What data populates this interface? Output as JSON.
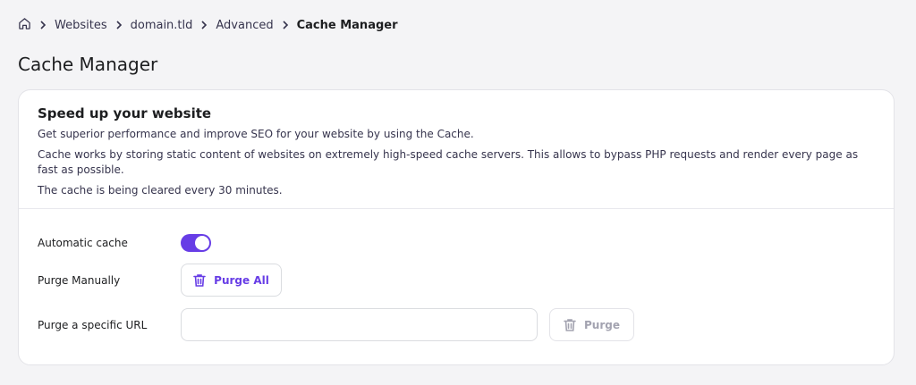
{
  "breadcrumb": {
    "home_icon": "home-icon",
    "items": [
      "Websites",
      "domain.tld",
      "Advanced",
      "Cache Manager"
    ]
  },
  "page_title": "Cache Manager",
  "card": {
    "title": "Speed up your website",
    "paragraphs": [
      "Get superior performance and improve SEO for your website by using the Cache.",
      "Cache works by storing static content of websites on extremely high-speed cache servers. This allows to bypass PHP requests and render every page as fast as possible.",
      "The cache is being cleared every 30 minutes."
    ]
  },
  "settings": {
    "automatic_cache": {
      "label": "Automatic cache",
      "enabled": true
    },
    "purge_manually": {
      "label": "Purge Manually",
      "button_label": "Purge All",
      "icon": "trash-icon"
    },
    "purge_url": {
      "label": "Purge a specific URL",
      "input_value": "",
      "input_placeholder": "",
      "button_label": "Purge",
      "icon": "trash-icon"
    }
  },
  "colors": {
    "accent": "#673de6",
    "background": "#f4f4f6",
    "card": "#ffffff",
    "text": "#1d1e20",
    "muted": "#a3a3b0"
  }
}
